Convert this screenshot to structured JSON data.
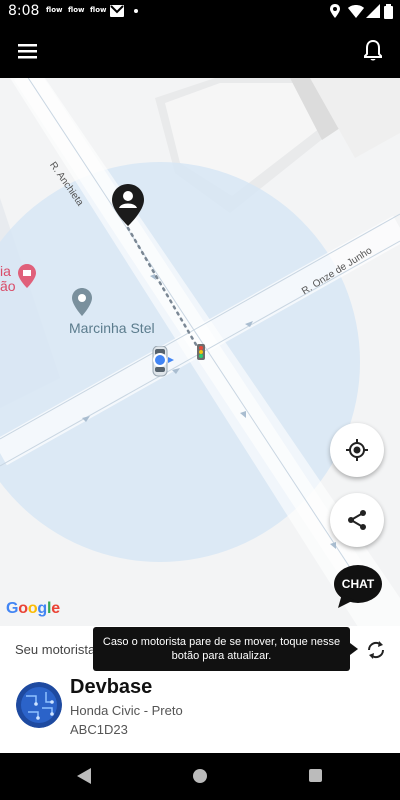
{
  "status_bar": {
    "time": "8:08",
    "app_icons": [
      "flow",
      "flow",
      "flow"
    ]
  },
  "app_bar": {
    "menu_icon": "hamburger-menu-icon",
    "notification_icon": "bell-icon"
  },
  "map": {
    "streets": {
      "anchieta": "R. Anchieta",
      "onze_de_junho": "R. Onze de Junho"
    },
    "poi_name": "Marcinha Stel",
    "poi_partial_top": "ia",
    "poi_partial_bottom": "ão",
    "attribution": "Google",
    "buttons": {
      "locate_icon": "my-location-icon",
      "share_icon": "share-icon",
      "chat_label": "CHAT"
    }
  },
  "driver_panel": {
    "header": "Seu motorista",
    "tooltip": "Caso o motorista pare de se mover, toque nesse botão para atualizar.",
    "refresh_icon": "refresh-icon",
    "driver_name": "Devbase",
    "car_model": "Honda Civic - Preto",
    "plate": "ABC1D23"
  },
  "nav_bar": {
    "back_icon": "back-icon",
    "home_icon": "home-icon",
    "recents_icon": "recents-icon"
  },
  "colors": {
    "accent_dark": "#000000",
    "location_blue": "#4285f4",
    "radius_fill": "#d7e6f4",
    "poi_red": "#d94c68"
  }
}
